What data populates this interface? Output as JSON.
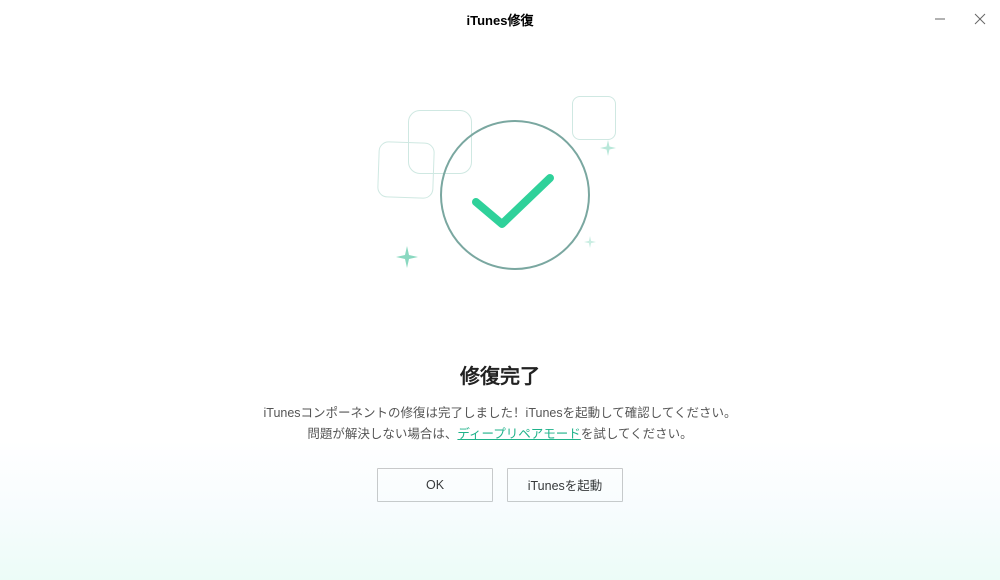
{
  "window": {
    "title": "iTunes修復"
  },
  "main": {
    "heading": "修復完了",
    "message_line1": "iTunesコンポーネントの修復は完了しました！iTunesを起動して確認してください。",
    "message_line2_prefix": "問題が解決しない場合は、",
    "message_line2_link": "ディープリペアモード",
    "message_line2_suffix": "を試してください。",
    "buttons": {
      "ok": "OK",
      "launch_itunes": "iTunesを起動"
    }
  }
}
